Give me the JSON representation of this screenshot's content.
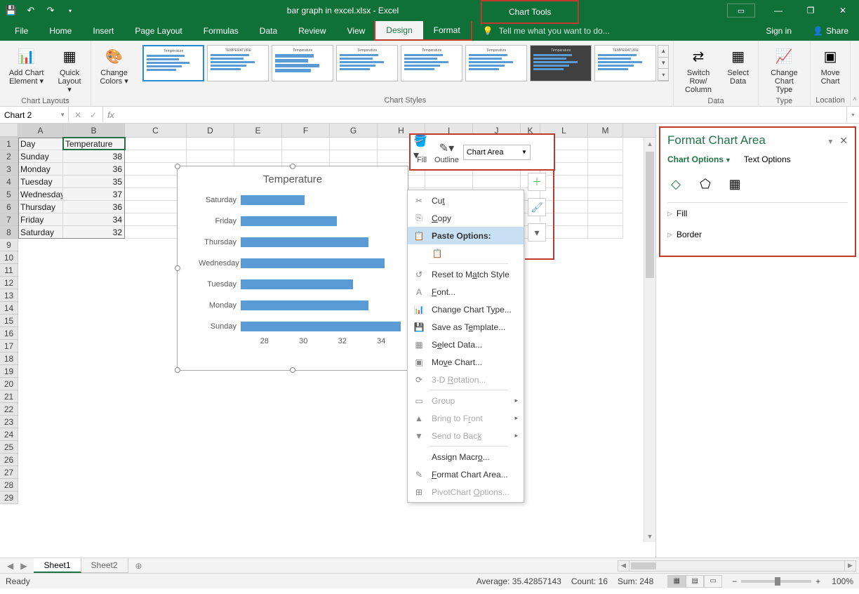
{
  "app": {
    "filename": "bar graph in excel.xlsx - Excel",
    "chart_tools": "Chart Tools",
    "signin": "Sign in",
    "share": "Share"
  },
  "tabs": {
    "file": "File",
    "home": "Home",
    "insert": "Insert",
    "page_layout": "Page Layout",
    "formulas": "Formulas",
    "data": "Data",
    "review": "Review",
    "view": "View",
    "design": "Design",
    "format": "Format",
    "tellme": "Tell me what you want to do..."
  },
  "ribbon": {
    "add_chart_element": "Add Chart Element",
    "quick_layout": "Quick Layout",
    "change_colors": "Change Colors",
    "group_layouts": "Chart Layouts",
    "group_styles": "Chart Styles",
    "switch_row_col": "Switch Row/ Column",
    "select_data": "Select Data",
    "group_data": "Data",
    "change_type": "Change Chart Type",
    "group_type": "Type",
    "move_chart": "Move Chart",
    "group_location": "Location"
  },
  "namebox": "Chart 2",
  "grid": {
    "cols": [
      "A",
      "B",
      "C",
      "D",
      "E",
      "F",
      "G",
      "H",
      "I",
      "J",
      "K",
      "L",
      "M"
    ],
    "rows": [
      {
        "A": "Day",
        "B": "Temperature"
      },
      {
        "A": "Sunday",
        "B": "38"
      },
      {
        "A": "Monday",
        "B": "36"
      },
      {
        "A": "Tuesday",
        "B": "35"
      },
      {
        "A": "Wednesday",
        "B": "37"
      },
      {
        "A": "Thursday",
        "B": "36"
      },
      {
        "A": "Friday",
        "B": "34"
      },
      {
        "A": "Saturday",
        "B": "32"
      }
    ]
  },
  "chart_data": {
    "type": "bar",
    "title": "Temperature",
    "categories": [
      "Sunday",
      "Monday",
      "Tuesday",
      "Wednesday",
      "Thursday",
      "Friday",
      "Saturday"
    ],
    "values": [
      38,
      36,
      35,
      37,
      36,
      34,
      32
    ],
    "xticks": [
      28,
      30,
      32,
      34
    ],
    "xlim": [
      28,
      38
    ]
  },
  "mini": {
    "fill": "Fill",
    "outline": "Outline",
    "dropdown": "Chart Area"
  },
  "ctx": {
    "cut": "Cut",
    "copy": "Copy",
    "paste_options": "Paste Options:",
    "reset": "Reset to Match Style",
    "font": "Font...",
    "change_type": "Change Chart Type...",
    "save_template": "Save as Template...",
    "select_data": "Select Data...",
    "move_chart": "Move Chart...",
    "rotation": "3-D Rotation...",
    "group": "Group",
    "bring_front": "Bring to Front",
    "send_back": "Send to Back",
    "assign_macro": "Assign Macro...",
    "format_area": "Format Chart Area...",
    "pivot_options": "PivotChart Options..."
  },
  "format_pane": {
    "title": "Format Chart Area",
    "chart_options": "Chart Options",
    "text_options": "Text Options",
    "fill": "Fill",
    "border": "Border"
  },
  "sheets": {
    "s1": "Sheet1",
    "s2": "Sheet2"
  },
  "status": {
    "ready": "Ready",
    "avg": "Average: 35.42857143",
    "count": "Count: 16",
    "sum": "Sum: 248",
    "zoom": "100%"
  }
}
